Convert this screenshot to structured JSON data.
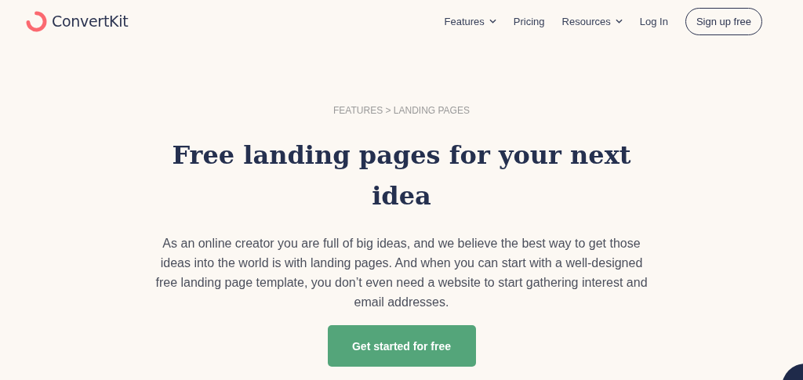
{
  "header": {
    "logo": "ConvertKit",
    "nav": [
      {
        "label": "Features",
        "dropdown": true
      },
      {
        "label": "Pricing",
        "dropdown": false
      },
      {
        "label": "Resources",
        "dropdown": true
      },
      {
        "label": "Log In",
        "dropdown": false
      }
    ],
    "signup_button": "Sign up free"
  },
  "hero": {
    "breadcrumb": "FEATURES > LANDING PAGES",
    "title": "Free landing pages for your next idea",
    "description": "As an online creator you are full of big ideas, and we believe the best way to get those ideas into the world is with landing pages. And when you can start with a well-designed free landing page template, you don’t even need a website to start gathering interest and email addresses.",
    "cta_button": "Get started for free"
  }
}
